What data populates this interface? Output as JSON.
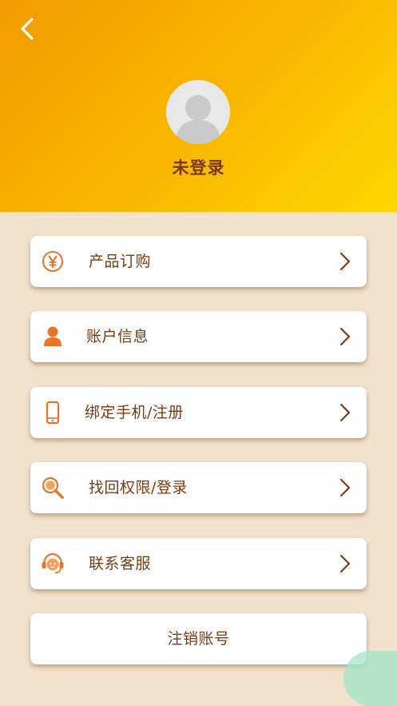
{
  "header": {
    "username": "未登录"
  },
  "menu": {
    "items": [
      {
        "label": "产品订购",
        "icon": "yuan-icon"
      },
      {
        "label": "账户信息",
        "icon": "user-icon"
      },
      {
        "label": "绑定手机/注册",
        "icon": "phone-icon"
      },
      {
        "label": "找回权限/登录",
        "icon": "search-icon"
      },
      {
        "label": "联系客服",
        "icon": "customer-service-icon"
      }
    ],
    "logout_label": "注销账号"
  },
  "colors": {
    "accent": "#e8742a",
    "text": "#7a3b12",
    "header_start": "#f39a00",
    "header_end": "#ffd600",
    "background": "#f2e1cc"
  }
}
